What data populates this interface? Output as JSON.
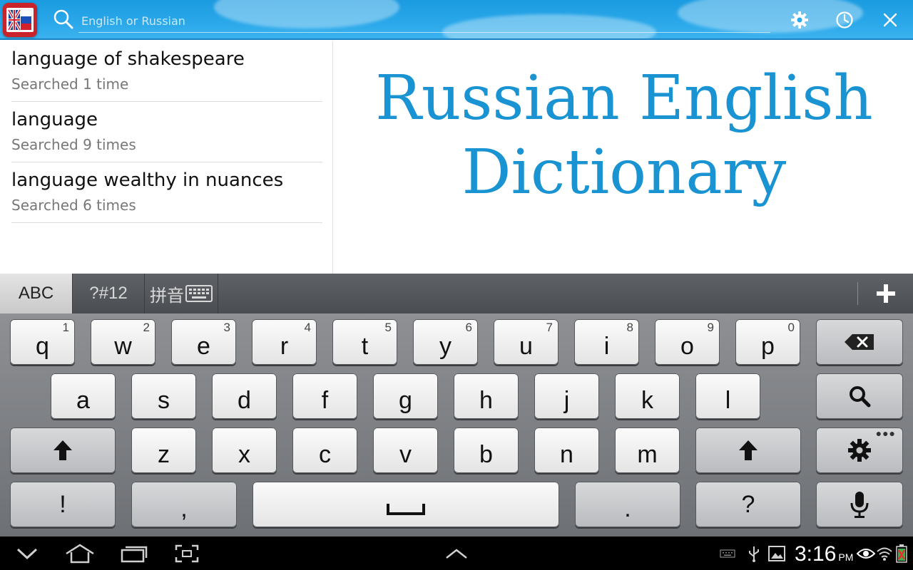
{
  "header": {
    "search_placeholder": "English or Russian",
    "icons": [
      "dictionary-app-icon",
      "search-icon",
      "settings-icon",
      "history-icon",
      "close-icon"
    ]
  },
  "history": [
    {
      "term": "language of shakespeare",
      "count": "Searched 1 time"
    },
    {
      "term": "language",
      "count": "Searched 9 times"
    },
    {
      "term": "language wealthy in nuances",
      "count": "Searched 6 times"
    }
  ],
  "logo": {
    "line1": "Russian English",
    "line2": "Dictionary"
  },
  "keyboard": {
    "modes": [
      "ABC",
      "?#12",
      "拼音"
    ],
    "row1": [
      {
        "k": "q",
        "s": "1"
      },
      {
        "k": "w",
        "s": "2"
      },
      {
        "k": "e",
        "s": "3"
      },
      {
        "k": "r",
        "s": "4"
      },
      {
        "k": "t",
        "s": "5"
      },
      {
        "k": "y",
        "s": "6"
      },
      {
        "k": "u",
        "s": "7"
      },
      {
        "k": "i",
        "s": "8"
      },
      {
        "k": "o",
        "s": "9"
      },
      {
        "k": "p",
        "s": "0"
      }
    ],
    "row2": [
      "a",
      "s",
      "d",
      "f",
      "g",
      "h",
      "j",
      "k",
      "l"
    ],
    "row3": [
      "z",
      "x",
      "c",
      "v",
      "b",
      "n",
      "m"
    ],
    "row4": {
      "excl": "!",
      "comma": ",",
      "period": ".",
      "question": "?"
    }
  },
  "status": {
    "time": "3:16",
    "ampm": "PM"
  },
  "colors": {
    "accent": "#1a93d3",
    "topbar": "#2aa8ea"
  }
}
